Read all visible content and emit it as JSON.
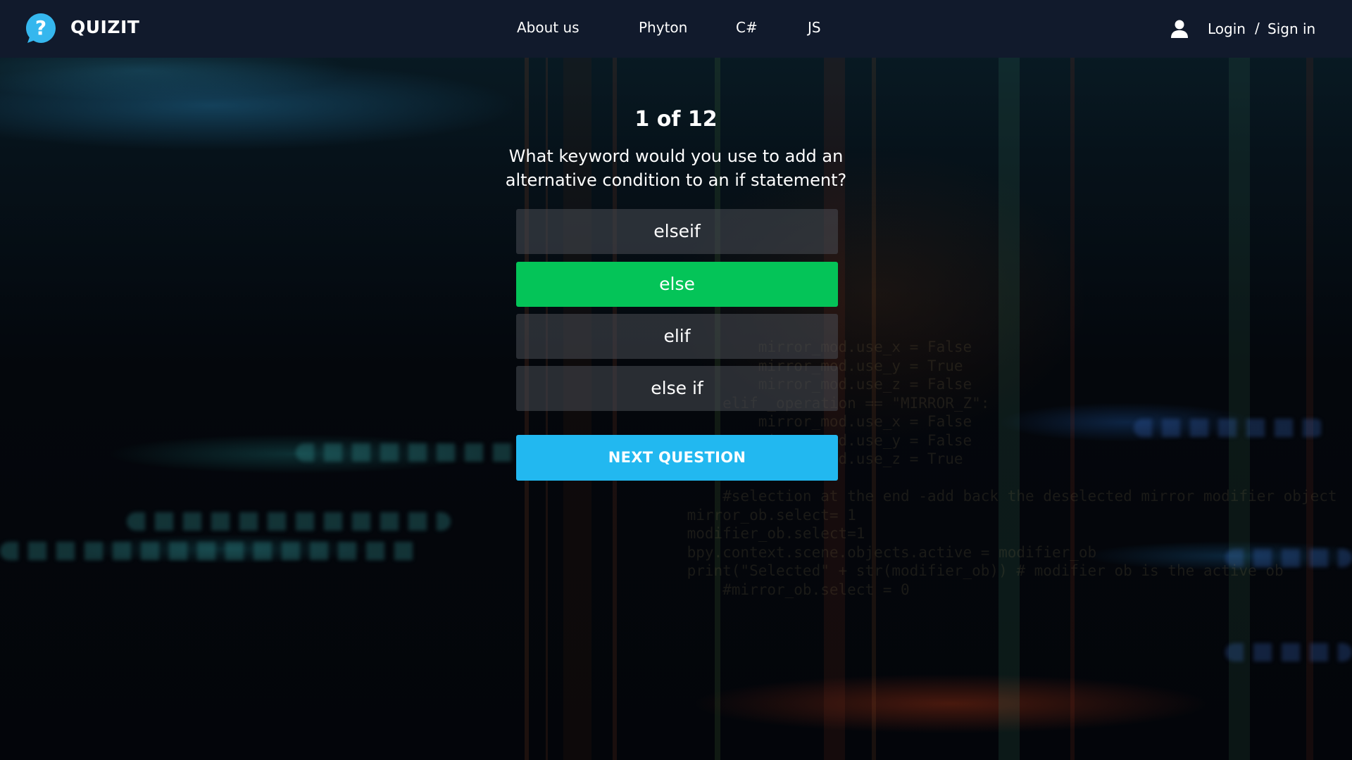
{
  "nav": {
    "brand": "QUIZIT",
    "links": [
      "About us",
      "Phyton",
      "C#",
      "JS"
    ],
    "login_label": "Login",
    "separator": "/",
    "signin_label": "Sign in"
  },
  "quiz": {
    "counter": "1 of 12",
    "question": "What keyword would you use to add an alternative condition to an if statement?",
    "options": [
      "elseif",
      "else",
      "elif",
      "else if"
    ],
    "selected_correct_option": "else",
    "next_label": "NEXT QUESTION"
  },
  "background_code": {
    "lines": [
      "            mirror_mod.use_x = False",
      "            mirror_mod.use_y = True",
      "            mirror_mod.use_z = False",
      "        elif _operation == \"MIRROR_Z\":",
      "            mirror_mod.use_x = False",
      "            mirror_mod.use_y = False",
      "            mirror_mod.use_z = True",
      "",
      "        #selection at the end -add back the deselected mirror modifier object",
      "    mirror_ob.select= 1",
      "    modifier_ob.select=1",
      "    bpy.context.scene.objects.active = modifier_ob",
      "    print(\"Selected\" + str(modifier_ob)) # modifier ob is the active ob",
      "        #mirror_ob.select = 0"
    ]
  },
  "colors": {
    "navbar": "#111a2c",
    "correct_option": "#04c458",
    "option": "#484c54",
    "next_button": "#22b8f0",
    "logo": "#35b7ee"
  },
  "icons": {
    "logo": "question-bubble-icon",
    "user": "user-icon"
  }
}
